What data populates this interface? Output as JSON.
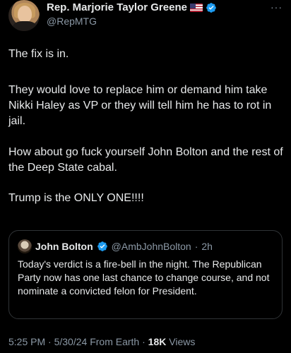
{
  "colors": {
    "background": "#000000",
    "text": "#e7e9ea",
    "secondary_text": "#8b98a5",
    "verified_badge": "#1d9bf0",
    "border": "#2f3336"
  },
  "author": {
    "name": "Rep. Marjorie Taylor Greene",
    "handle": "@RepMTG",
    "flag_icon": "us-flag-icon",
    "badge_icon": "verified-badge-icon"
  },
  "more_icon": "···",
  "post": {
    "paragraphs": [
      "The fix is in.",
      "They would love to replace him or demand him take Nikki Haley as VP or they will tell him he has to rot in jail.",
      "How about go fuck yourself John Bolton and the rest of the Deep State cabal.",
      "Trump is the ONLY ONE!!!!"
    ]
  },
  "quote": {
    "name": "John Bolton",
    "handle": "@AmbJohnBolton",
    "time": "2h",
    "text": "Today's verdict is a fire-bell in the night. The Republican Party now has one last chance to change course, and not nominate a convicted felon for President."
  },
  "meta": {
    "time": "5:25 PM",
    "date": "5/30/24",
    "source": "From Earth",
    "views_count": "18K",
    "views_label": "Views"
  }
}
